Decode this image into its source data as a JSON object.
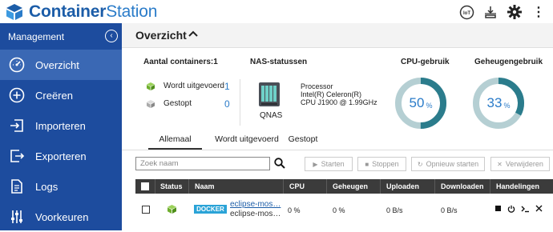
{
  "header": {
    "brand_part1": "Container",
    "brand_part2": "Station",
    "icons": [
      "iot-icon",
      "queue-icon",
      "gear-icon",
      "more-icon"
    ],
    "iot_label": "IoT",
    "more_label": "⋮"
  },
  "sidebar": {
    "title": "Management",
    "collapse_glyph": "‹",
    "items": [
      {
        "label": "Overzicht",
        "icon": "gauge-icon",
        "active": true
      },
      {
        "label": "Creëren",
        "icon": "plus-icon"
      },
      {
        "label": "Importeren",
        "icon": "import-icon"
      },
      {
        "label": "Exporteren",
        "icon": "export-icon"
      },
      {
        "label": "Logs",
        "icon": "document-icon"
      },
      {
        "label": "Voorkeuren",
        "icon": "sliders-icon"
      }
    ]
  },
  "overview": {
    "title": "Overzicht",
    "containers": {
      "label": "Aantal containers:1",
      "running_label": "Wordt uitgevoerd",
      "running_count": "1",
      "stopped_label": "Gestopt",
      "stopped_count": "0"
    },
    "nas": {
      "label": "NAS-statussen",
      "name": "QNAS",
      "processor_lines": [
        "Processor",
        "Intel(R) Celeron(R)",
        "CPU J1900 @ 1.99GHz"
      ]
    },
    "cpu": {
      "label": "CPU-gebruik",
      "value": "50",
      "unit": "%",
      "fraction": 0.5
    },
    "memory": {
      "label": "Geheugengebruik",
      "value": "33",
      "unit": "%",
      "fraction": 0.33
    },
    "colors": {
      "accent": "#2b7cc9",
      "gauge_fill": "#2b7c8c",
      "gauge_track": "#b5cfd3",
      "sidebar": "#1d4c9e",
      "sidebar_active": "#3a68b4"
    }
  },
  "tabs": [
    {
      "label": "Allemaal",
      "active": true
    },
    {
      "label": "Wordt uitgevoerd"
    },
    {
      "label": "Gestopt"
    }
  ],
  "toolbar": {
    "search_placeholder": "Zoek naam",
    "start_label": "Starten",
    "stop_label": "Stoppen",
    "restart_label": "Opnieuw starten",
    "delete_label": "Verwijderen"
  },
  "table": {
    "columns": [
      "Status",
      "Naam",
      "CPU",
      "Geheugen",
      "Uploaden",
      "Downloaden",
      "Handelingen"
    ],
    "rows": [
      {
        "type": "DOCKER",
        "name": "eclipse-mos…",
        "image": "eclipse-mos…",
        "cpu": "0 %",
        "memory": "0 %",
        "upload": "0 B/s",
        "download": "0 B/s",
        "actions": [
          "stop-icon",
          "power-icon",
          "terminal-icon",
          "close-icon"
        ]
      }
    ]
  }
}
